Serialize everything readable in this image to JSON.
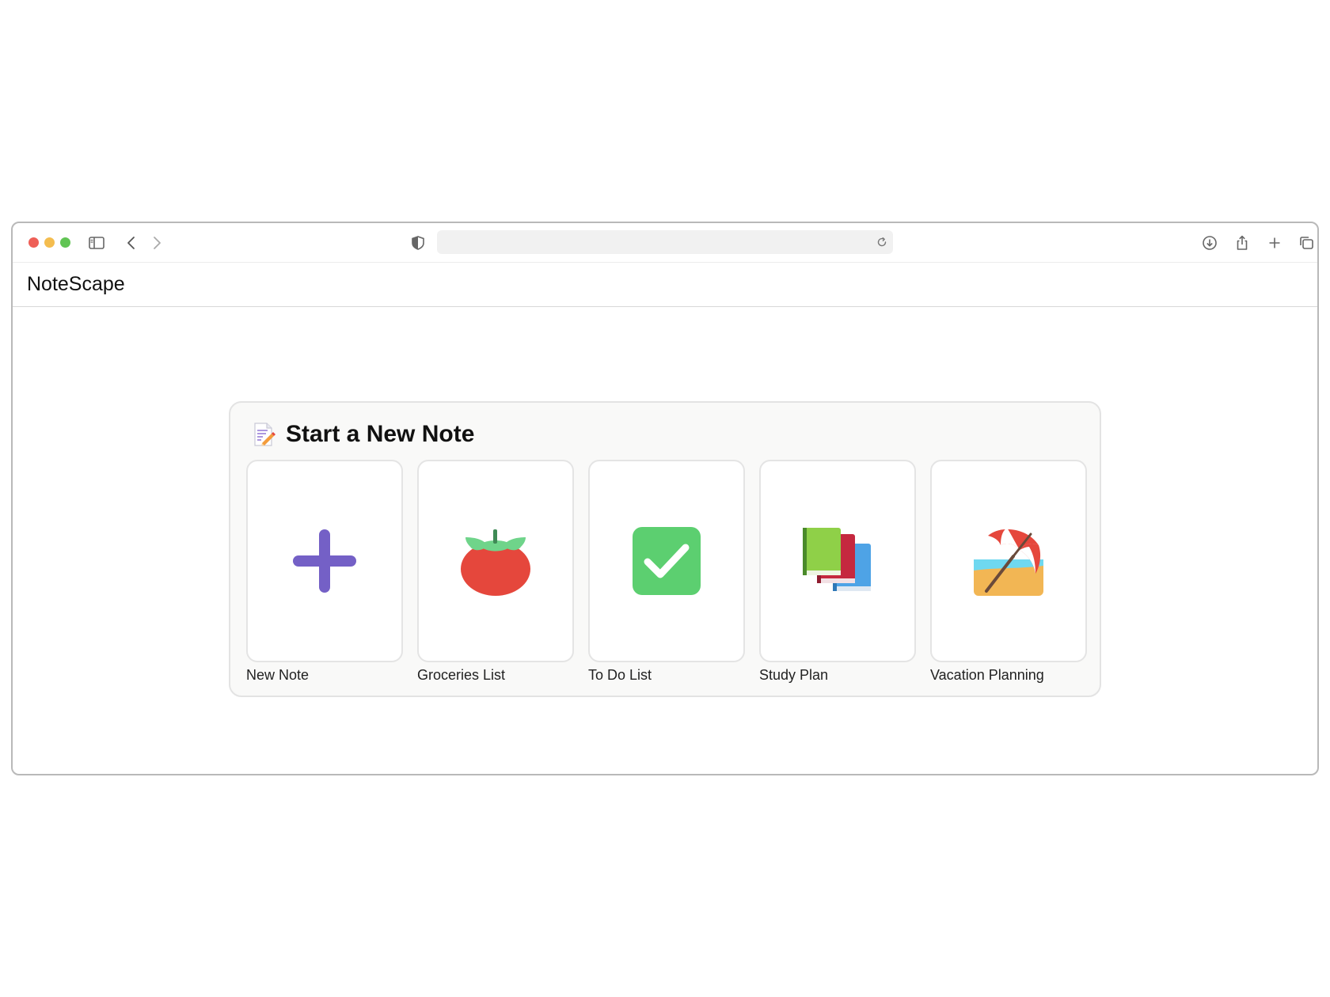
{
  "app": {
    "title": "NoteScape"
  },
  "browser": {
    "url": "",
    "icons": [
      "sidebar-icon",
      "back-icon",
      "forward-icon",
      "shield-icon",
      "reload-icon",
      "download-icon",
      "share-icon",
      "new-tab-icon",
      "tabs-overview-icon"
    ]
  },
  "panel": {
    "title": "Start a New Note",
    "icon": "memo-icon",
    "templates": [
      {
        "label": "New Note",
        "icon": "plus-icon"
      },
      {
        "label": "Groceries List",
        "icon": "tomato-icon"
      },
      {
        "label": "To Do List",
        "icon": "checkmark-icon"
      },
      {
        "label": "Study Plan",
        "icon": "books-icon"
      },
      {
        "label": "Vacation Planning",
        "icon": "beach-umbrella-icon"
      }
    ]
  },
  "colors": {
    "accent_plus": "#7460c6",
    "tomato": "#e5473c",
    "check": "#5ccf70",
    "panel_bg": "#f9f9f8"
  }
}
